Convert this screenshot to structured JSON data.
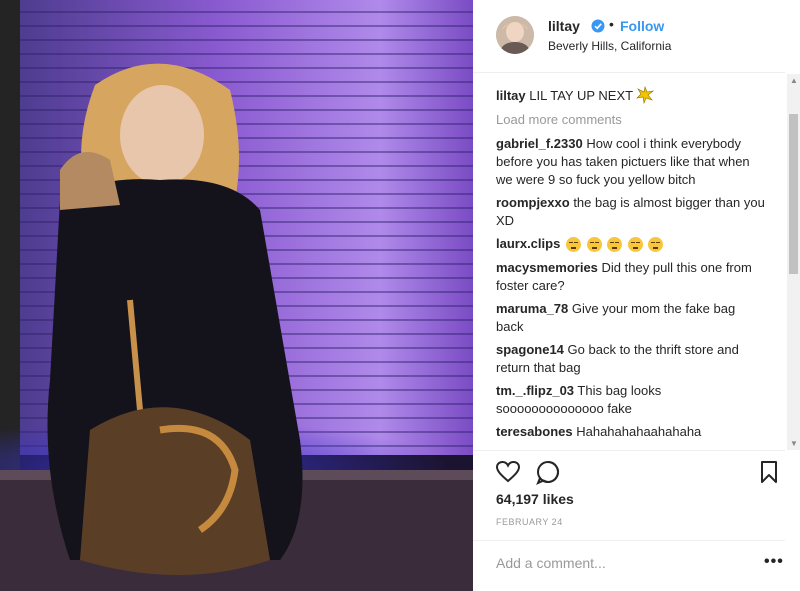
{
  "post": {
    "username": "liltay",
    "follow_label": "Follow",
    "dot": "•",
    "location": "Beverly Hills, California",
    "caption": {
      "user": "liltay",
      "text": "LIL TAY UP NEXT"
    },
    "load_more": "Load more comments",
    "comments": [
      {
        "user": "gabriel_f.2330",
        "text": "How cool i think everybody before you has taken pictuers like that when we were 9 so fuck you yellow bitch"
      },
      {
        "user": "roompjexxo",
        "text": "the bag is almost bigger than you XD"
      },
      {
        "user": "laurx.clips",
        "text": ""
      },
      {
        "user": "macysmemories",
        "text": "Did they pull this one from foster care?"
      },
      {
        "user": "maruma_78",
        "text": "Give your mom the fake bag back"
      },
      {
        "user": "spagone14",
        "text": "Go back to the thrift store and return that bag"
      },
      {
        "user": "tm._.flipz_03",
        "text": "This bag looks soooooooooooooo fake"
      },
      {
        "user": "teresabones",
        "text": "Hahahahahaahahaha"
      }
    ],
    "likes": "64,197 likes",
    "date": "FEBRUARY 24",
    "add_comment_placeholder": "Add a comment...",
    "more_label": "•••"
  },
  "icons": {
    "verified": "verified-badge-icon",
    "like": "heart-icon",
    "comment": "comment-bubble-icon",
    "save": "bookmark-icon",
    "emoji": "unamused-face-icon",
    "caption_emoji": "sparkle-icon"
  },
  "colors": {
    "link_blue": "#3897f0",
    "text": "#262626",
    "muted": "#999999",
    "border": "#efefef"
  }
}
